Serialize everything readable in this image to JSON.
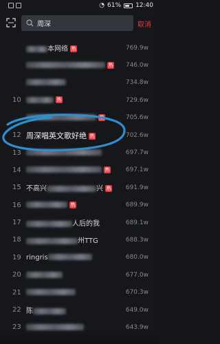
{
  "status_bar": {
    "battery": "61%",
    "time": "12:40"
  },
  "search": {
    "query": "周深",
    "cancel": "取消",
    "placeholder": ""
  },
  "hot_badge": "热",
  "items": [
    {
      "rank": "",
      "title": "",
      "suffix": "本网络",
      "count": "769.9w",
      "hot": true
    },
    {
      "rank": "",
      "title": "",
      "suffix": "",
      "count": "746.0w",
      "hot": true
    },
    {
      "rank": "",
      "title": "",
      "suffix": "",
      "count": "734.8w",
      "hot": false
    },
    {
      "rank": "10",
      "title": "",
      "suffix": "",
      "count": "729.6w",
      "hot": true
    },
    {
      "rank": "",
      "title": "",
      "suffix": "",
      "count": "705.6w",
      "hot": true
    },
    {
      "rank": "12",
      "title": "周深唱英文歌好绝",
      "suffix": "",
      "count": "702.6w",
      "hot": true
    },
    {
      "rank": "13",
      "title": "",
      "suffix": "",
      "count": "697.7w",
      "hot": false
    },
    {
      "rank": "14",
      "title": "",
      "suffix": "",
      "count": "697.1w",
      "hot": true
    },
    {
      "rank": "15",
      "title": "不高兴",
      "suffix": "兴",
      "count": "691.9w",
      "hot": true
    },
    {
      "rank": "16",
      "title": "",
      "suffix": "",
      "count": "689.9w",
      "hot": true
    },
    {
      "rank": "17",
      "title": "",
      "suffix": "人后的我",
      "count": "689.1w",
      "hot": false
    },
    {
      "rank": "18",
      "title": "",
      "suffix": "州TTG",
      "count": "688.3w",
      "hot": false
    },
    {
      "rank": "19",
      "title": "ringris",
      "suffix": "",
      "count": "680.0w",
      "hot": false
    },
    {
      "rank": "20",
      "title": "",
      "suffix": "",
      "count": "677.0w",
      "hot": false
    },
    {
      "rank": "21",
      "title": "",
      "suffix": "",
      "count": "670.3w",
      "hot": false
    },
    {
      "rank": "22",
      "title": "陈",
      "suffix": "",
      "count": "649.0w",
      "hot": false
    },
    {
      "rank": "23",
      "title": "",
      "suffix": "",
      "count": "643.9w",
      "hot": false
    }
  ]
}
